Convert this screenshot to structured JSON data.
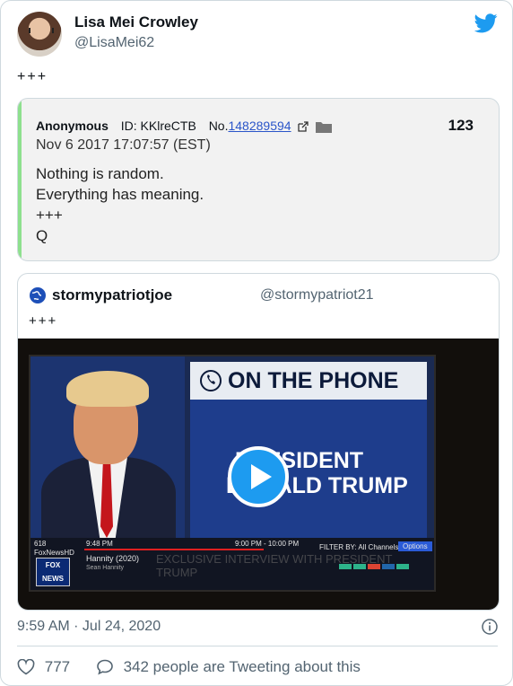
{
  "author": {
    "name": "Lisa Mei Crowley",
    "handle": "@LisaMei62"
  },
  "tweet": {
    "text": "+++",
    "timestamp": "9:59 AM · Jul 24, 2020"
  },
  "qpost": {
    "author": "Anonymous",
    "id": "ID: KKlreCTB",
    "no_prefix": "No.",
    "no": "148289594",
    "count": "123",
    "date": "Nov 6 2017 17:07:57 (EST)",
    "lines": [
      "Nothing is random.",
      "Everything has meaning.",
      "+++",
      "Q"
    ]
  },
  "quoted": {
    "name": "stormypatriotjoe",
    "handle": "@stormypatriot21",
    "text": "+++"
  },
  "video": {
    "banner": "ON THE PHONE",
    "caption_line1": "PRESIDENT",
    "caption_line2": "DONALD TRUMP",
    "guide": {
      "channel": "618",
      "network": "FoxNewsHD",
      "time_now": "9:48 PM",
      "time_slot": "9:00 PM - 10:00 PM",
      "filter": "FILTER BY: All Channels",
      "options": "Options",
      "show": "Hannity (2020)",
      "host": "Sean Hannity",
      "logo": "FOX NEWS",
      "marquee": "EXCLUSIVE INTERVIEW WITH PRESIDENT TRUMP"
    }
  },
  "actions": {
    "likes": "777",
    "reply_text": "342 people are Tweeting about this"
  },
  "colors": {
    "accent": "#1d9bf0",
    "qpost_bar": "#8ee08e",
    "link": "#2a55c9"
  }
}
